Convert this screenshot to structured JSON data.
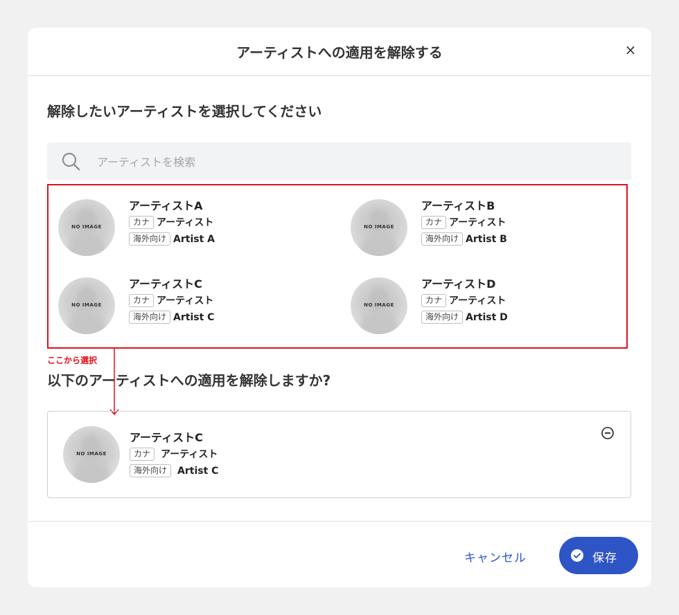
{
  "modal": {
    "title": "アーティストへの適用を解除する",
    "close_glyph": "×"
  },
  "select_section": {
    "heading": "解除したいアーティストを選択してください"
  },
  "search": {
    "placeholder": "アーティストを検索",
    "value": ""
  },
  "no_image_text": "NO IMAGE",
  "tag_labels": {
    "kana": "カナ",
    "overseas": "海外向け"
  },
  "artists": [
    {
      "name": "アーティストA",
      "kana": "アーティスト",
      "overseas": "Artist A"
    },
    {
      "name": "アーティストB",
      "kana": "アーティスト",
      "overseas": "Artist B"
    },
    {
      "name": "アーティストC",
      "kana": "アーティスト",
      "overseas": "Artist C"
    },
    {
      "name": "アーティストD",
      "kana": "アーティスト",
      "overseas": "Artist D"
    }
  ],
  "annotation": {
    "label": "ここから選択",
    "color": "#e0101a"
  },
  "confirm_section": {
    "heading": "以下のアーティストへの適用を解除しますか?"
  },
  "selected": {
    "name": "アーティストC",
    "kana": "アーティスト",
    "overseas": "Artist C"
  },
  "footer": {
    "cancel_label": "キャンセル",
    "save_label": "保存"
  },
  "colors": {
    "primary": "#2d55c6",
    "annotation": "#e0101a",
    "search_bg": "#f2f3f5"
  },
  "icons": {
    "search": "search-icon",
    "close": "close-icon",
    "remove": "minus-circle-icon",
    "save": "check-circle-icon"
  }
}
